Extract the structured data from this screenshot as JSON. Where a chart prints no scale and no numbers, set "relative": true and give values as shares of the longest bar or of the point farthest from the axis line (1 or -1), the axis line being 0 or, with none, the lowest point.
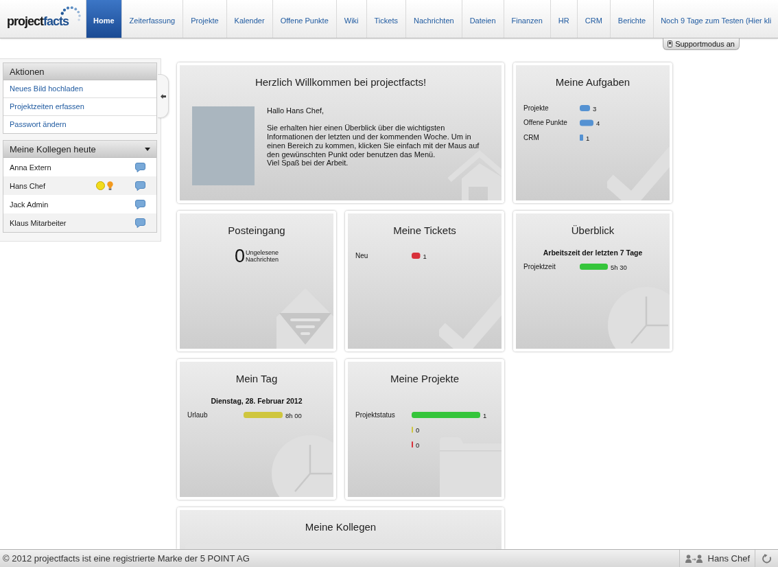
{
  "header": {
    "logo": {
      "text": "project",
      "accent_text": "facts"
    },
    "tabs": [
      {
        "label": "Home",
        "selected": true
      },
      {
        "label": "Zeiterfassung",
        "selected": false
      },
      {
        "label": "Projekte",
        "selected": false
      },
      {
        "label": "Kalender",
        "selected": false
      },
      {
        "label": "Offene Punkte",
        "selected": false
      },
      {
        "label": "Wiki",
        "selected": false
      },
      {
        "label": "Tickets",
        "selected": false
      },
      {
        "label": "Nachrichten",
        "selected": false
      },
      {
        "label": "Dateien",
        "selected": false
      },
      {
        "label": "Finanzen",
        "selected": false
      },
      {
        "label": "HR",
        "selected": false
      },
      {
        "label": "CRM",
        "selected": false
      },
      {
        "label": "Berichte",
        "selected": false
      },
      {
        "label": "Noch 9 Tage zum Testen (Hier kli",
        "selected": false
      }
    ],
    "support_button": "Supportmodus an"
  },
  "sidebar": {
    "actions": {
      "title": "Aktionen",
      "links": [
        "Neues Bild hochladen",
        "Projektzeiten erfassen",
        "Passwort ändern"
      ]
    },
    "colleagues": {
      "title": "Meine Kollegen heute",
      "people": [
        {
          "name": "Anna Extern",
          "online": false,
          "lightbulb": false
        },
        {
          "name": "Hans Chef",
          "online": true,
          "lightbulb": true
        },
        {
          "name": "Jack Admin",
          "online": false,
          "lightbulb": false
        },
        {
          "name": "Klaus Mitarbeiter",
          "online": false,
          "lightbulb": false
        }
      ]
    }
  },
  "cards": [
    {
      "kind": "welcome",
      "title": "Herzlich Willkommen bei projectfacts!",
      "greeting": "Hallo Hans Chef,",
      "message": "Sie erhalten hier einen Überblick über die wichtigsten Informationen der letzten und der kommenden Woche. Um in einen Bereich zu kommen, klicken Sie einfach mit der Maus auf den gewünschten Punkt oder benutzen das Menü.",
      "closing": "Viel Spaß bei der Arbeit."
    },
    {
      "kind": "tasks",
      "title": "Meine Aufgaben",
      "chart_data": {
        "type": "bar",
        "orientation": "horizontal",
        "categories": [
          "Projekte",
          "Offene Punkte",
          "CRM"
        ],
        "series": [
          {
            "color": "#5592d2",
            "values": [
              3,
              4,
              1
            ]
          }
        ],
        "data_labels": true
      }
    },
    {
      "kind": "inbox",
      "title": "Posteingang",
      "count": "0",
      "count_label": "Ungelesene Nachrichten"
    },
    {
      "kind": "tickets",
      "title": "Meine Tickets",
      "chart_data": {
        "type": "bar",
        "orientation": "horizontal",
        "categories": [
          "Neu"
        ],
        "series": [
          {
            "color": "#d8313b",
            "values": [
              1
            ]
          }
        ],
        "data_labels": true
      }
    },
    {
      "kind": "overview",
      "title": "Überblick",
      "subtitle": "Arbeitszeit der letzten 7 Tage",
      "chart_data": {
        "type": "bar",
        "orientation": "horizontal",
        "relative": true,
        "categories": [
          "Projektzeit"
        ],
        "series": [
          {
            "color": "#35c53b",
            "values": [
              1
            ]
          }
        ],
        "value_labels": [
          "5h 30"
        ]
      }
    },
    {
      "kind": "day",
      "title": "Mein Tag",
      "subtitle": "Dienstag, 28. Februar 2012",
      "chart_data": {
        "type": "bar",
        "orientation": "horizontal",
        "relative": true,
        "categories": [
          "Urlaub"
        ],
        "series": [
          {
            "color": "#cfc63e",
            "values": [
              1
            ]
          }
        ],
        "value_labels": [
          "8h 00"
        ]
      }
    },
    {
      "kind": "projects",
      "title": "Meine Projekte",
      "chart_data": {
        "type": "bar",
        "orientation": "horizontal",
        "relative": true,
        "categories": [
          "Projektstatus"
        ],
        "series": [
          {
            "color": "#35c53b",
            "values": [
              1
            ]
          },
          {
            "color": "#cfc63e",
            "values": [
              0
            ]
          },
          {
            "color": "#d8313b",
            "values": [
              0
            ]
          }
        ],
        "value_labels": [
          "1",
          "0",
          "0"
        ]
      }
    },
    {
      "kind": "colleagues",
      "title": "Meine Kollegen"
    }
  ],
  "footer": {
    "copyright": "© 2012 projectfacts ist eine registrierte Marke der 5 POINT AG",
    "user": "Hans Chef"
  }
}
